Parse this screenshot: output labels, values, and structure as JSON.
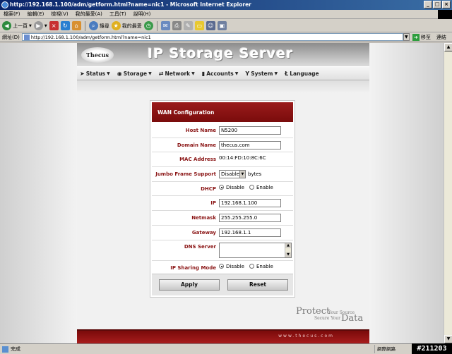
{
  "window": {
    "title": "http://192.168.1.100/adm/getform.html?name=nic1 - Microsoft Internet Explorer"
  },
  "menu": [
    "檔案(F)",
    "編輯(E)",
    "檢視(V)",
    "我的最愛(A)",
    "工具(T)",
    "說明(H)"
  ],
  "toolbar": {
    "back": "上一頁",
    "search": "搜尋",
    "favorites": "我的最愛"
  },
  "address": {
    "label": "網址(D)",
    "url": "http://192.168.1.100/adm/getform.html?name=nic1",
    "go": "移至",
    "links": "連結"
  },
  "site": {
    "logo": "Thecus",
    "title": "IP Storage Server",
    "nav": [
      "Status",
      "Storage",
      "Network",
      "Accounts",
      "System",
      "Language"
    ],
    "footer_url": "www.thecus.com",
    "tagline": {
      "protect": "Protect",
      "your_source": "Your Source",
      "secure_your": "Secure Your",
      "data": "Data"
    }
  },
  "form": {
    "title": "WAN Configuration",
    "host_name": {
      "label": "Host Name",
      "value": "N5200"
    },
    "domain_name": {
      "label": "Domain Name",
      "value": "thecus.com"
    },
    "mac_address": {
      "label": "MAC Address",
      "value": "00:14:FD:10:8C:6C"
    },
    "jumbo": {
      "label": "Jumbo Frame Support",
      "value": "Disable",
      "unit": "bytes"
    },
    "dhcp": {
      "label": "DHCP",
      "option_disable": "Disable",
      "option_enable": "Enable",
      "selected": "Disable"
    },
    "ip": {
      "label": "IP",
      "value": "192.168.1.100"
    },
    "netmask": {
      "label": "Netmask",
      "value": "255.255.255.0"
    },
    "gateway": {
      "label": "Gateway",
      "value": "192.168.1.1"
    },
    "dns": {
      "label": "DNS Server",
      "value": ""
    },
    "ip_sharing": {
      "label": "IP Sharing Mode",
      "option_disable": "Disable",
      "option_enable": "Enable",
      "selected": "Disable"
    },
    "apply_label": "Apply",
    "reset_label": "Reset"
  },
  "status": {
    "text": "完成",
    "zone": "網際網路",
    "watermark": "#211203"
  },
  "colors": {
    "accent": "#8a1414",
    "titlebar": "#0a246a"
  }
}
